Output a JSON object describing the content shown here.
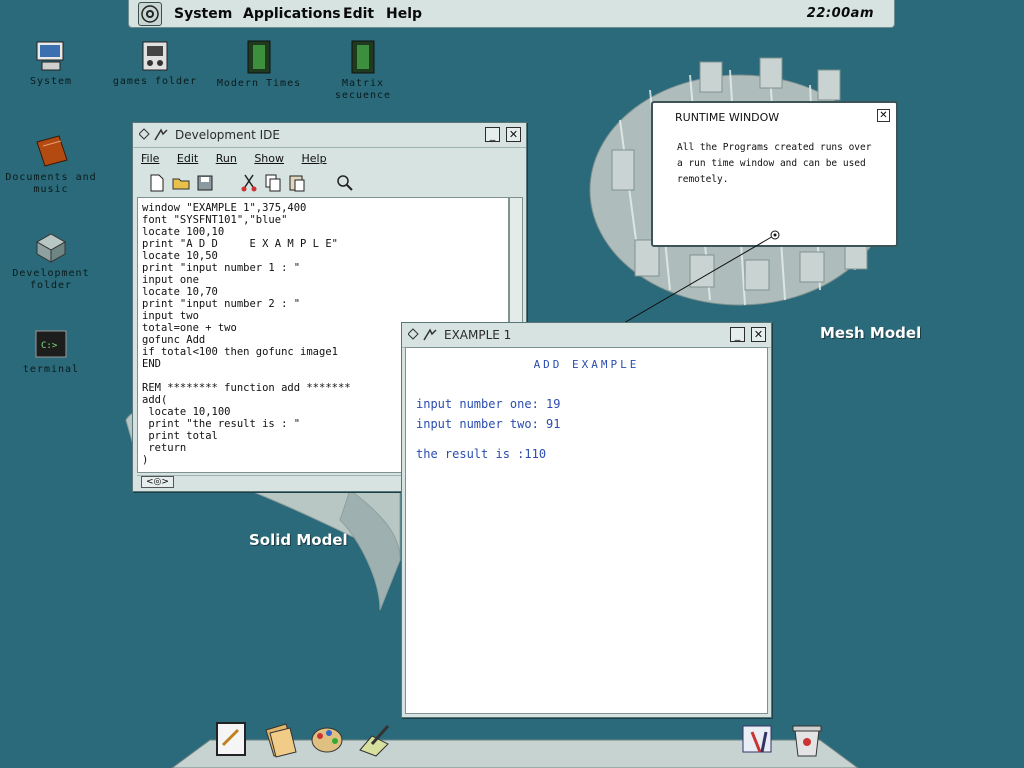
{
  "menubar": {
    "items": [
      "System",
      "Applications",
      "Edit",
      "Help"
    ],
    "clock": "22:00am"
  },
  "desktop": {
    "icons": [
      {
        "label": "System",
        "icon": "computer-icon"
      },
      {
        "label": "games folder",
        "icon": "games-folder-icon"
      },
      {
        "label": "Modern Times",
        "icon": "film-icon"
      },
      {
        "label": "Matrix secuence",
        "icon": "film-icon"
      },
      {
        "label": "Documents and music",
        "icon": "folder-icon"
      },
      {
        "label": "Development folder",
        "icon": "development-icon"
      },
      {
        "label": "terminal",
        "icon": "terminal-icon"
      }
    ]
  },
  "background": {
    "solid_label": "Solid Model",
    "mesh_label": "Mesh Model"
  },
  "ide": {
    "title": "Development IDE",
    "menu": [
      "File",
      "Edit",
      "Run",
      "Show",
      "Help"
    ],
    "toolbar_icons": [
      "new-file-icon",
      "open-folder-icon",
      "save-icon",
      "cut-icon",
      "copy-icon",
      "paste-icon",
      "search-icon"
    ],
    "code": "window \"EXAMPLE 1\",375,400\nfont \"SYSFNT101\",\"blue\"\nlocate 100,10\nprint \"A D D     E X A M P L E\"\nlocate 10,50\nprint \"input number 1 : \"\ninput one\nlocate 10,70\nprint \"input number 2 : \"\ninput two\ntotal=one + two\ngofunc Add\nif total<100 then gofunc image1\nEND\n\nREM ******** function add *******\nadd(\n locate 10,100\n print \"the result is : \"\n print total\n return\n)",
    "hscroll_thumb": "<◎>"
  },
  "example": {
    "title": "EXAMPLE 1",
    "heading": "ADD EXAMPLE",
    "line1": "input number one: 19",
    "line2": "input number two: 91",
    "line3": "the result is :110"
  },
  "runtime": {
    "title": "RUNTIME WINDOW",
    "text": "All the Programs created runs over a run time window and can be used remotely."
  },
  "dock": {
    "items": [
      "notepad-icon",
      "documents-icon",
      "paint-palette-icon",
      "draw-icon",
      "tools-icon",
      "trash-icon"
    ]
  },
  "colors": {
    "desktop": "#2b6a7a",
    "chrome": "#d6e3e1",
    "example_text": "#2a4db0"
  }
}
